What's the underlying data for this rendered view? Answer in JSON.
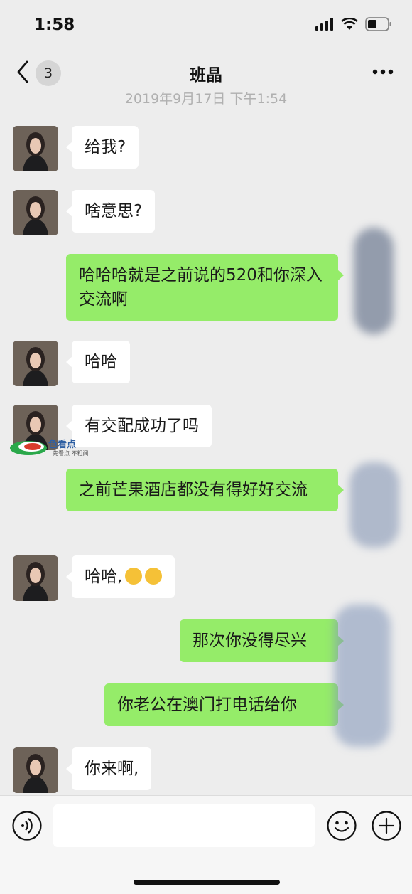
{
  "status_bar": {
    "time": "1:58"
  },
  "nav": {
    "unread_count": "3",
    "title": "班晶",
    "back_icon": "chevron-left-icon",
    "more_icon": "more-dots-icon"
  },
  "timestamp": "2019年9月17日 下午1:54",
  "messages": [
    {
      "side": "in",
      "text": "给我?"
    },
    {
      "side": "in",
      "text": "啥意思?"
    },
    {
      "side": "out",
      "text": "哈哈哈就是之前说的520和你深入交流啊"
    },
    {
      "side": "in",
      "text": "哈哈"
    },
    {
      "side": "in",
      "text": "有交配成功了吗"
    },
    {
      "side": "out",
      "text": "之前芒果酒店都没有得好好交流"
    },
    {
      "side": "in",
      "text": "哈哈,",
      "emoji": "smirk-emoji"
    },
    {
      "side": "out",
      "text": "那次你没得尽兴"
    },
    {
      "side": "out",
      "text": "你老公在澳门打电话给你"
    },
    {
      "side": "in",
      "text": "你来啊,"
    }
  ],
  "watermark": {
    "text": "色看点",
    "subtext": "先看点 不粗阅"
  },
  "input_bar": {
    "placeholder": "",
    "voice_icon": "voice-icon",
    "emoji_icon": "emoji-smile-icon",
    "plus_icon": "plus-circle-icon"
  },
  "colors": {
    "background": "#ededed",
    "incoming_bubble": "#ffffff",
    "outgoing_bubble": "#95ec69"
  }
}
